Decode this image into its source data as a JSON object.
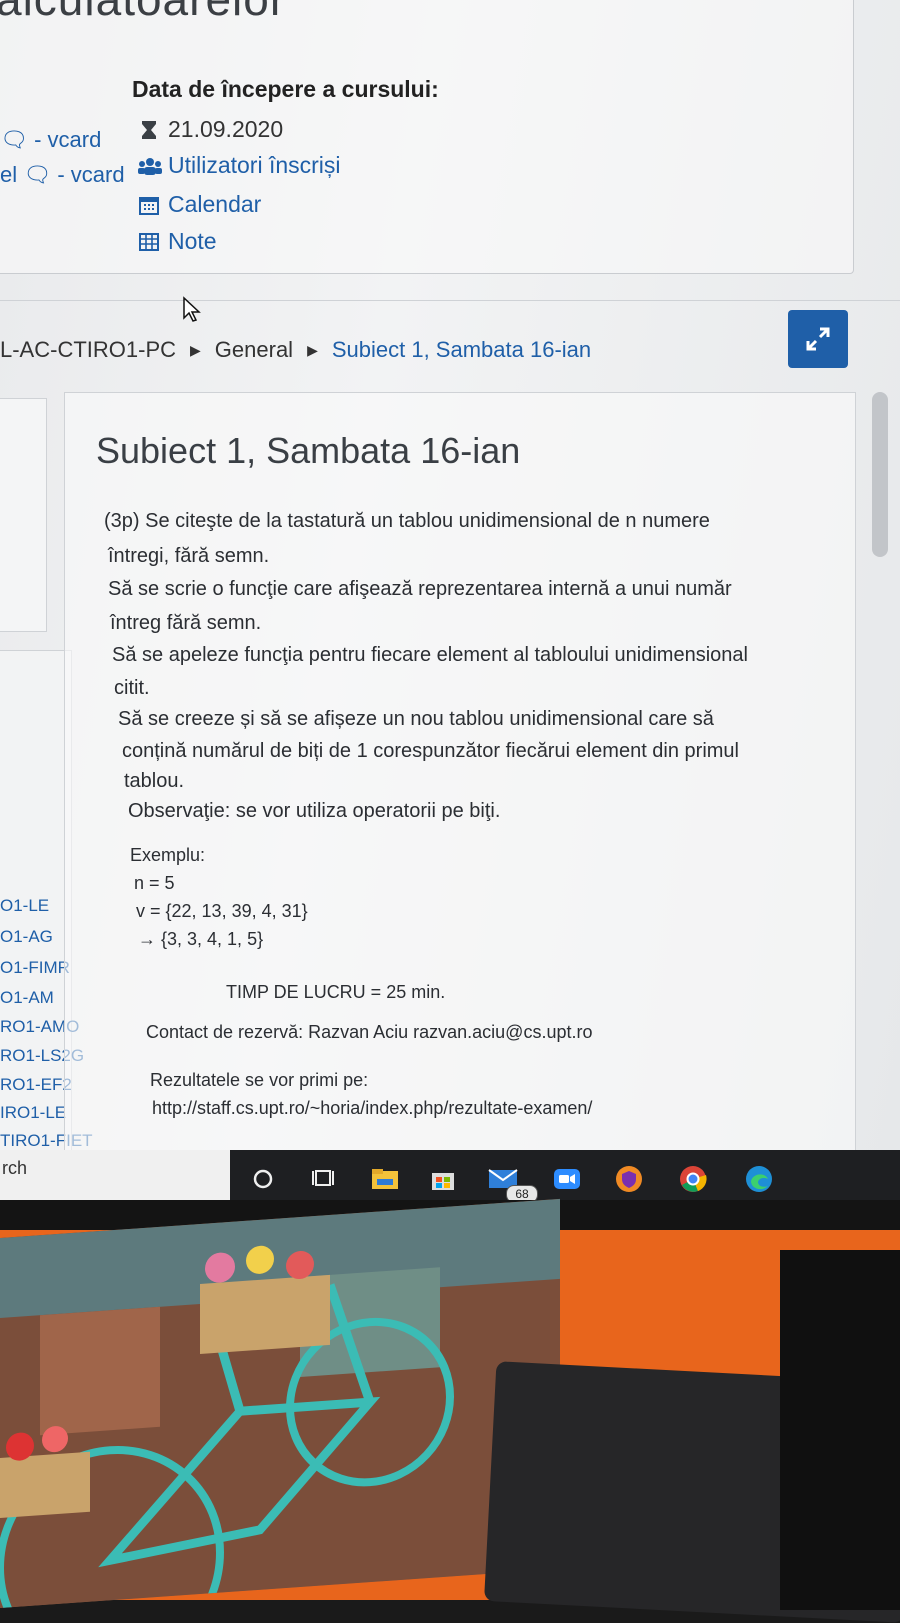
{
  "header": {
    "partial_title": "alculatoarelor",
    "vcard_1": "- vcard",
    "vcard_2": "- vcard",
    "start_label": "Data de începere a cursului:",
    "start_date": "21.09.2020",
    "links": [
      "Utilizatori înscriși",
      "Calendar",
      "Note"
    ]
  },
  "breadcrumb": {
    "items": [
      "L-AC-CTIRO1-PC",
      "General",
      "Subiect 1, Sambata 16-ian"
    ]
  },
  "sidebar": {
    "items": [
      "O1-LE",
      "O1-AG",
      "O1-FIMR",
      "O1-AM",
      "RO1-AMO",
      "RO1-LS2G",
      "RO1-EF2",
      "IRO1-LE",
      "TIRO1-FIET"
    ]
  },
  "main": {
    "title": "Subiect 1, Sambata 16-ian",
    "lines": [
      "(3p) Se citeşte de la tastatură un tablou unidimensional de n numere",
      "întregi, fără semn.",
      "Să se scrie o funcţie care afişează reprezentarea internă a unui număr",
      "întreg fără semn.",
      "Să se apeleze funcţia pentru fiecare element al tabloului unidimensional",
      "citit.",
      "Să se creeze și să se afișeze un nou tablou unidimensional care să",
      "conțină numărul de biți de 1 corespunzător fiecărui element din primul",
      "tablou.",
      "Observaţie: se vor utiliza operatorii pe biţi."
    ],
    "example": [
      "Exemplu:",
      "n = 5",
      "v = {22, 13, 39, 4, 31}",
      "→ {3, 3, 4, 1, 5}"
    ],
    "time": "TIMP DE LUCRU = 25 min.",
    "contact": "Contact de rezervă: Razvan Aciu razvan.aciu@cs.upt.ro",
    "results_label": "Rezultatele se vor primi pe:",
    "results_url": "http://staff.cs.upt.ro/~horia/index.php/rezultate-examen/"
  },
  "taskbar": {
    "search_text": "rch",
    "mail_badge": "68",
    "icons": [
      "cortana-icon",
      "task-view-icon",
      "file-explorer-icon",
      "store-icon",
      "mail-icon",
      "zoom-icon",
      "browser-shield-icon",
      "chrome-icon",
      "edge-icon"
    ]
  },
  "colors": {
    "link": "#1f5fa8",
    "button": "#1f5fa8",
    "taskbar": "#1e1f22"
  }
}
